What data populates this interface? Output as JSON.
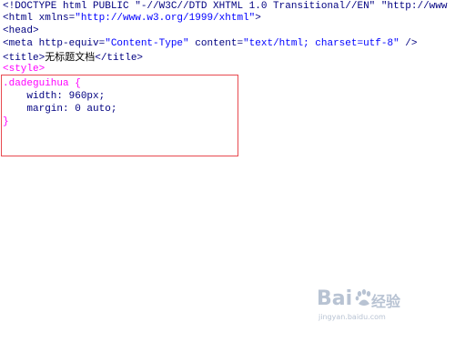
{
  "code_lines": [
    {
      "parts": [
        {
          "t": "<!DOCTYPE html PUBLIC \"-//W3C//DTD XHTML 1.0 Transitional//EN\" \"http://www",
          "c": "tag"
        }
      ]
    },
    {
      "parts": [
        {
          "t": "<html xmlns=",
          "c": "tag"
        },
        {
          "t": "\"http://www.w3.org/1999/xhtml\"",
          "c": "val"
        },
        {
          "t": ">",
          "c": "tag"
        }
      ]
    },
    {
      "parts": [
        {
          "t": "<head>",
          "c": "tag"
        }
      ]
    },
    {
      "parts": [
        {
          "t": "<meta http-equiv=",
          "c": "tag"
        },
        {
          "t": "\"Content-Type\"",
          "c": "val"
        },
        {
          "t": " content=",
          "c": "tag"
        },
        {
          "t": "\"text/html; charset=utf-8\"",
          "c": "val"
        },
        {
          "t": " />",
          "c": "tag"
        }
      ]
    },
    {
      "parts": [
        {
          "t": "<title>",
          "c": "tag"
        },
        {
          "t": "无标题文档",
          "c": "txt"
        },
        {
          "t": "</title>",
          "c": "tag"
        }
      ]
    },
    {
      "parts": [
        {
          "t": "<style>",
          "c": "pink"
        }
      ]
    },
    {
      "parts": [
        {
          "t": ".dadeguihua {",
          "c": "pink"
        }
      ]
    },
    {
      "parts": [
        {
          "t": "    width: 960px;",
          "c": "cssprop"
        }
      ]
    },
    {
      "parts": [
        {
          "t": "    margin: 0 auto;",
          "c": "cssprop"
        }
      ]
    },
    {
      "parts": [
        {
          "t": "}",
          "c": "pink"
        }
      ]
    }
  ],
  "watermark": {
    "brand_left": "Bai",
    "brand_right": "经验",
    "url": "jingyan.baidu.com"
  },
  "colors": {
    "tag": "#000080",
    "value": "#0000ff",
    "css_selector": "#ff00ff",
    "highlight_border": "#e8494f",
    "watermark": "#b8c3d3"
  }
}
